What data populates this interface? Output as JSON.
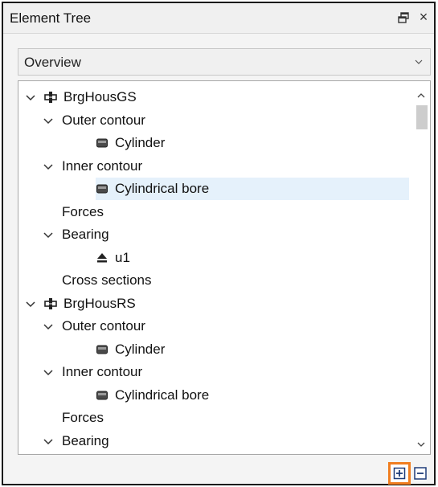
{
  "panel": {
    "title": "Element Tree"
  },
  "dropdown": {
    "selected": "Overview"
  },
  "tree": {
    "rows": [
      {
        "label": "BrgHousGS",
        "depth": 0,
        "chevron": "down",
        "icon": "shaft-icon"
      },
      {
        "label": "Outer contour",
        "depth": 1,
        "chevron": "down",
        "icon": ""
      },
      {
        "label": "Cylinder",
        "depth": 2,
        "chevron": "",
        "icon": "cylinder-icon"
      },
      {
        "label": "Inner contour",
        "depth": 1,
        "chevron": "down",
        "icon": ""
      },
      {
        "label": "Cylindrical bore",
        "depth": 2,
        "chevron": "",
        "icon": "cylindrical-bore-icon",
        "selected": true
      },
      {
        "label": "Forces",
        "depth": 1,
        "chevron": "",
        "icon": ""
      },
      {
        "label": "Bearing",
        "depth": 1,
        "chevron": "down",
        "icon": ""
      },
      {
        "label": "u1",
        "depth": 2,
        "chevron": "",
        "icon": "bearing-icon"
      },
      {
        "label": "Cross sections",
        "depth": 1,
        "chevron": "",
        "icon": ""
      },
      {
        "label": "BrgHousRS",
        "depth": 0,
        "chevron": "down",
        "icon": "shaft-icon"
      },
      {
        "label": "Outer contour",
        "depth": 1,
        "chevron": "down",
        "icon": ""
      },
      {
        "label": "Cylinder",
        "depth": 2,
        "chevron": "",
        "icon": "cylinder-icon"
      },
      {
        "label": "Inner contour",
        "depth": 1,
        "chevron": "down",
        "icon": ""
      },
      {
        "label": "Cylindrical bore",
        "depth": 2,
        "chevron": "",
        "icon": "cylindrical-bore-icon"
      },
      {
        "label": "Forces",
        "depth": 1,
        "chevron": "",
        "icon": ""
      },
      {
        "label": "Bearing",
        "depth": 1,
        "chevron": "down",
        "icon": ""
      }
    ]
  },
  "footer": {
    "expand_icon": "expand-all-icon",
    "collapse_icon": "collapse-all-icon",
    "highlight_color": "#f07d20"
  },
  "colors": {
    "selection": "#e5f1fb",
    "panel_background": "#f4f4f4"
  }
}
